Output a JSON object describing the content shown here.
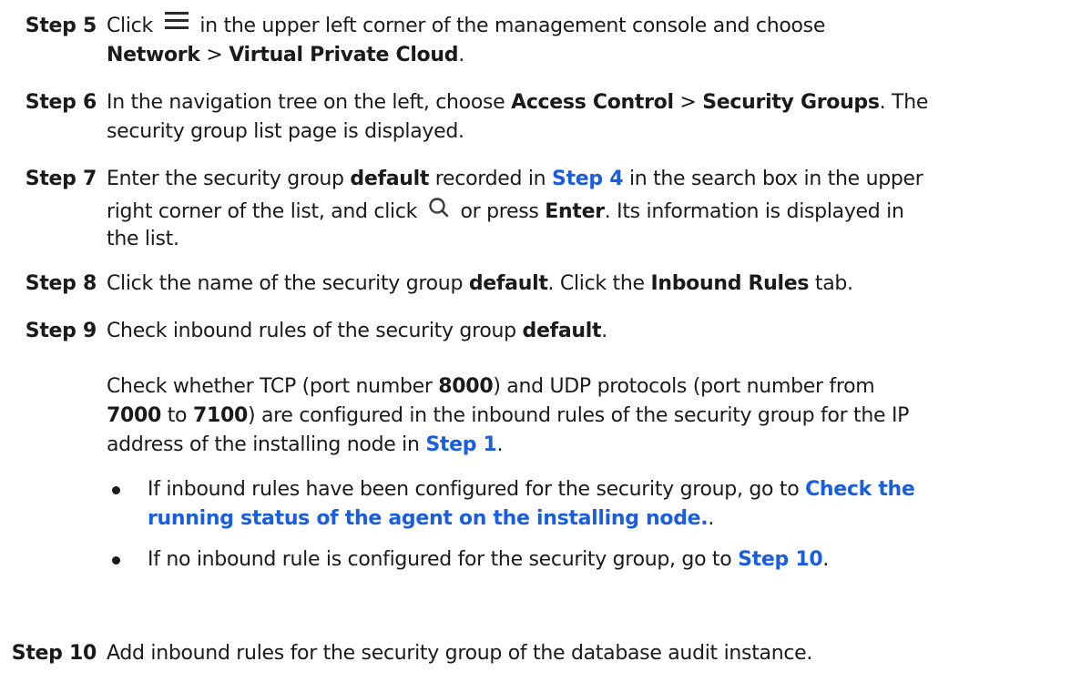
{
  "steps": {
    "s5": {
      "label": "Step 5",
      "t1": "Click",
      "t2": "in the upper left corner of the management console and choose",
      "b1": "Network",
      "sep": ">",
      "b2": "Virtual Private Cloud",
      "end": "."
    },
    "s6": {
      "label": "Step 6",
      "t1": "In the navigation tree on the left, choose",
      "b1": "Access Control",
      "sep": ">",
      "b2": "Security Groups",
      "t2": ". The",
      "t3": "security group list page is displayed."
    },
    "s7": {
      "label": "Step 7",
      "t1": "Enter the security group",
      "b1": "default",
      "t2": "recorded in",
      "link": "Step 4",
      "t3": "in the search box in the upper",
      "t4": "right corner of the list, and click",
      "t5": "or press",
      "b2": "Enter",
      "t6": ". Its information is displayed in",
      "t7": "the list."
    },
    "s8": {
      "label": "Step 8",
      "t1": "Click the name of the security group",
      "b1": "default",
      "t2": ". Click the",
      "b2": "Inbound Rules",
      "t3": "tab."
    },
    "s9": {
      "label": "Step 9",
      "t1": "Check inbound rules of the security group",
      "b1": "default",
      "end": ".",
      "p1": "Check whether TCP (port number",
      "p1b": "8000",
      "p2": ") and UDP protocols (port number from",
      "p3b": "7000",
      "p4": "to",
      "p5b": "7100",
      "p6": ") are configured in the inbound rules of the security group for the IP",
      "p7": "address of the installing node in",
      "p7link": "Step 1",
      "p8": ".",
      "bullet1_t1": "If inbound rules have been configured for the security group, go to",
      "bullet1_link1": "Check the",
      "bullet1_link2": "running status of the agent on the installing node.",
      "bullet1_end": ".",
      "bullet2_t1": "If no inbound rule is configured for the security group, go to",
      "bullet2_link": "Step 10",
      "bullet2_end": "."
    },
    "s10": {
      "label": "Step 10",
      "t1": "Add inbound rules for the security group of the database audit instance."
    }
  },
  "colors": {
    "text": "#1a1a1a",
    "link": "#1a5ee0"
  },
  "icons": [
    "menu-icon",
    "search-icon"
  ]
}
